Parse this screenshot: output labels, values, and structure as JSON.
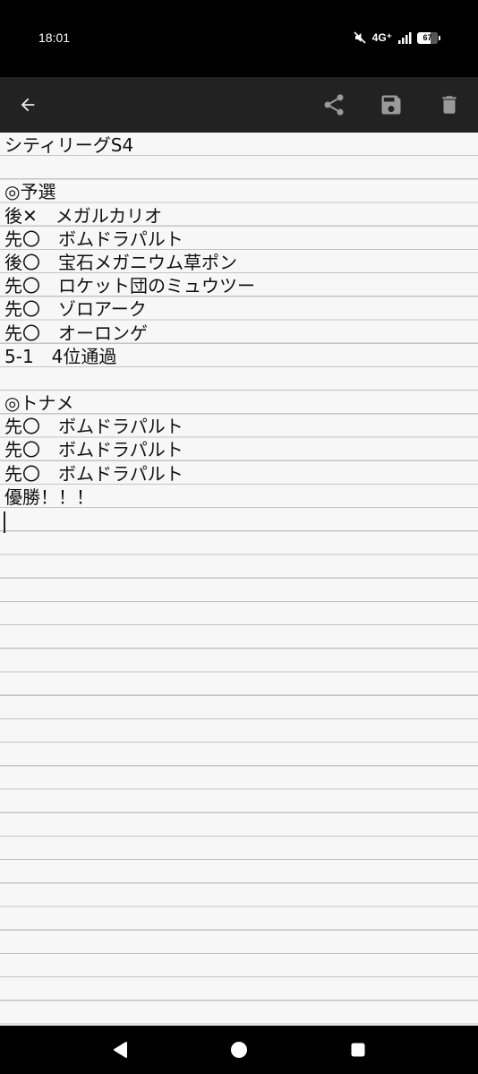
{
  "status_bar": {
    "time": "18:01",
    "network": "4G⁺",
    "battery_text": "67",
    "battery_level": 0.67
  },
  "toolbar": {
    "back_icon": "arrow-left-icon",
    "share_icon": "share-icon",
    "save_icon": "floppy-disk-icon",
    "delete_icon": "trash-icon",
    "background": "#222222"
  },
  "note": {
    "lines": [
      "シティリーグS4",
      "",
      "◎予選",
      "後✕　メガルカリオ",
      "先〇　ボムドラパルト",
      "後〇　宝石メガニウム草ポン",
      "先〇　ロケット団のミュウツー",
      "先〇　ゾロアーク",
      "先〇　オーロンゲ",
      "5-1　4位通過",
      "",
      "◎トナメ",
      "先〇　ボムドラパルト",
      "先〇　ボムドラパルト",
      "先〇　ボムドラパルト",
      "優勝！！！"
    ],
    "background": "#f7f7f7",
    "rule_color": "#c4c4c4"
  },
  "nav_bar": {
    "back_icon": "triangle-back-icon",
    "home_icon": "circle-home-icon",
    "recents_icon": "square-recents-icon"
  }
}
